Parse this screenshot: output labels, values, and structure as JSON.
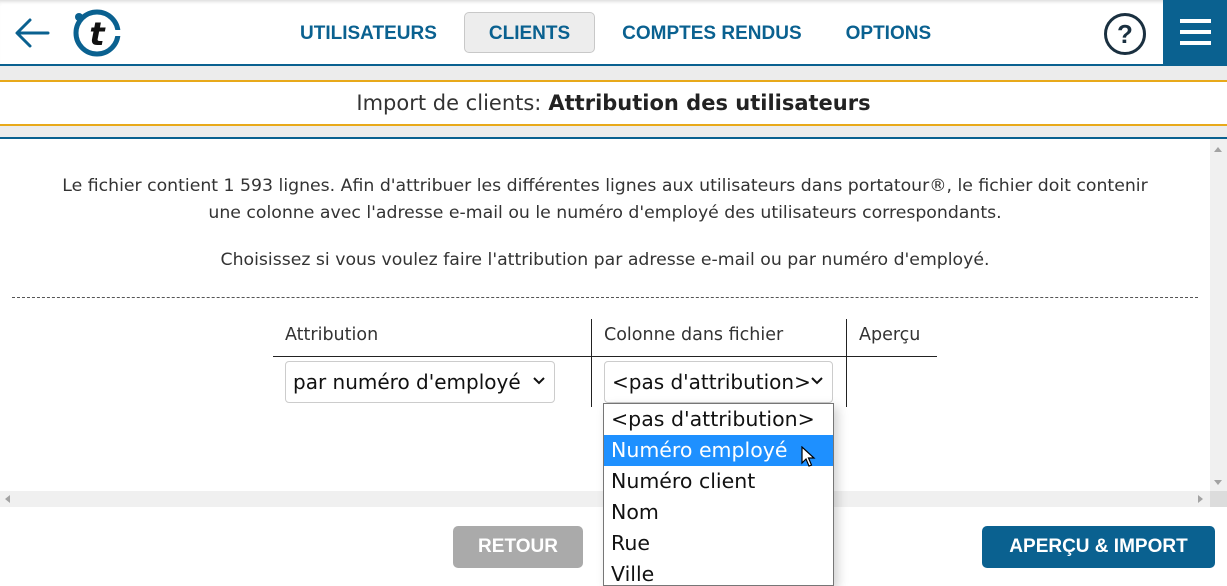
{
  "header": {
    "nav": [
      {
        "label": "UTILISATEURS",
        "active": false
      },
      {
        "label": "CLIENTS",
        "active": true
      },
      {
        "label": "COMPTES RENDUS",
        "active": false
      },
      {
        "label": "OPTIONS",
        "active": false
      }
    ],
    "help_label": "?",
    "icons": {
      "back": "arrow-left-icon",
      "logo": "portatour-logo",
      "help": "help-circle-icon",
      "menu": "hamburger-menu-icon"
    }
  },
  "title": {
    "prefix": "Import de clients:",
    "main": "Attribution des utilisateurs"
  },
  "intro": {
    "line1": "Le fichier contient 1 593 lignes. Afin d'attribuer les différentes lignes aux utilisateurs dans portatour®, le fichier doit contenir",
    "line2": "une colonne avec l'adresse e-mail ou le numéro d'employé des utilisateurs correspondants.",
    "line3": "Choisissez si vous voulez faire l'attribution par adresse e-mail ou par numéro d'employé."
  },
  "table": {
    "headers": [
      "Attribution",
      "Colonne dans fichier",
      "Aperçu"
    ],
    "attribution_value": "par numéro d'employé",
    "column_value": "<pas d'attribution>",
    "preview_value": ""
  },
  "dropdown": {
    "options": [
      "<pas d'attribution>",
      "Numéro employé",
      "Numéro client",
      "Nom",
      "Rue",
      "Ville"
    ],
    "highlighted": "Numéro employé"
  },
  "footer": {
    "back_label": "RETOUR",
    "import_label": "APERÇU & IMPORT"
  },
  "colors": {
    "brand": "#0a6190",
    "accent": "#e8a91a",
    "highlight": "#1e90ff"
  }
}
